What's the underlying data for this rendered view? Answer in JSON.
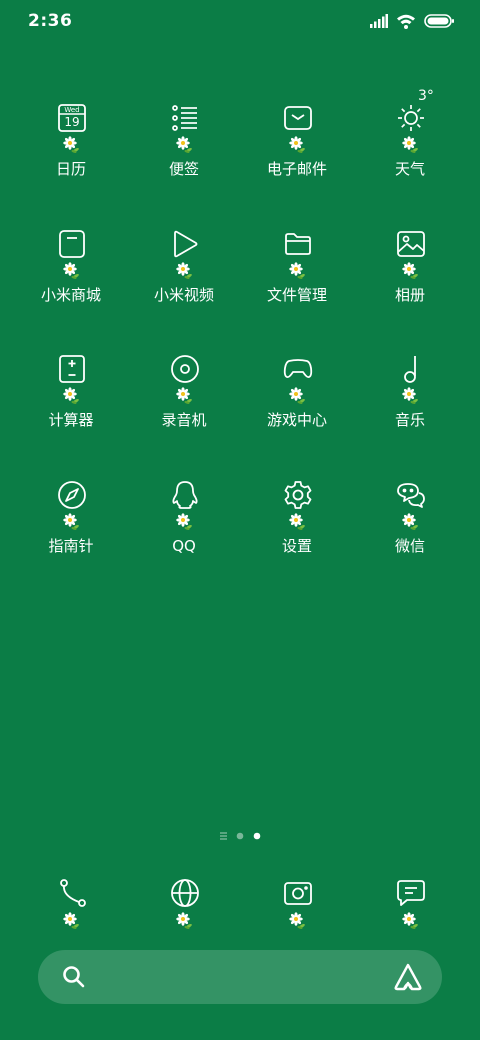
{
  "status_bar": {
    "time": "2:36",
    "icons": [
      "signal-icon",
      "wifi-icon",
      "battery-icon"
    ]
  },
  "calendar_icon": {
    "weekday": "Wed",
    "day": "19"
  },
  "weather": {
    "temp": "3°"
  },
  "apps": [
    {
      "label": "日历",
      "icon": "calendar-icon"
    },
    {
      "label": "便签",
      "icon": "notes-icon"
    },
    {
      "label": "电子邮件",
      "icon": "email-icon"
    },
    {
      "label": "天气",
      "icon": "weather-icon"
    },
    {
      "label": "小米商城",
      "icon": "mi-store-icon"
    },
    {
      "label": "小米视频",
      "icon": "video-icon"
    },
    {
      "label": "文件管理",
      "icon": "folder-icon"
    },
    {
      "label": "相册",
      "icon": "gallery-icon"
    },
    {
      "label": "计算器",
      "icon": "calculator-icon"
    },
    {
      "label": "录音机",
      "icon": "recorder-icon"
    },
    {
      "label": "游戏中心",
      "icon": "gamepad-icon"
    },
    {
      "label": "音乐",
      "icon": "music-icon"
    },
    {
      "label": "指南针",
      "icon": "compass-icon"
    },
    {
      "label": "QQ",
      "icon": "qq-icon"
    },
    {
      "label": "设置",
      "icon": "gear-icon"
    },
    {
      "label": "微信",
      "icon": "wechat-icon"
    }
  ],
  "page_indicator": {
    "pages": 3,
    "current": 3
  },
  "dock": [
    {
      "icon": "phone-icon"
    },
    {
      "icon": "browser-icon"
    },
    {
      "icon": "camera-icon"
    },
    {
      "icon": "messages-icon"
    }
  ],
  "colors": {
    "background": "#0b7d46",
    "foreground": "#ffffff"
  }
}
